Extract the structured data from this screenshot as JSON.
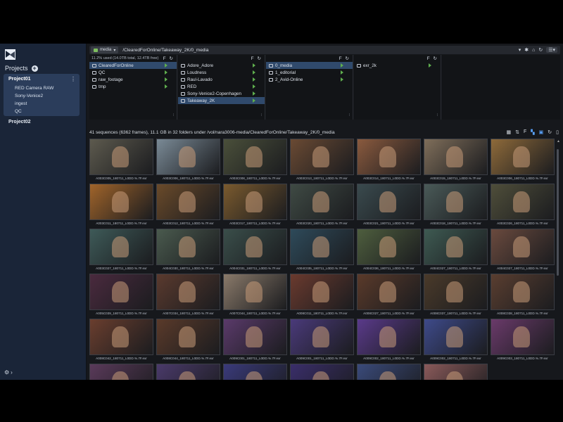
{
  "sidebar": {
    "projects_title": "Projects",
    "current_project": {
      "name": "Project01",
      "items": [
        "RED Camera RAW",
        "Sony-Venice2",
        "ingest",
        "QC"
      ]
    },
    "other_project": "Project02"
  },
  "pathbar": {
    "drive": "media",
    "path": "/ClearedForOnline/Takeaway_2K/0_media"
  },
  "browser": {
    "usage": "11.2% used (14.0TB total, 12.4TB free)",
    "columns": [
      {
        "items": [
          "ClearedForOnline",
          "QC",
          "raw_footage",
          "tmp"
        ],
        "selected": 0
      },
      {
        "items": [
          "Adore_Adore",
          "Loudness",
          "Raul-Lavado",
          "RED",
          "Sony-Venice2-Copenhagen",
          "Takeaway_2K"
        ],
        "selected": 5
      },
      {
        "items": [
          "0_media",
          "1_editorial",
          "2_Avid-Online"
        ],
        "selected": 0
      },
      {
        "items": [
          "exr_2k"
        ],
        "selected": -1
      },
      {
        "items": [],
        "selected": -1
      }
    ]
  },
  "info": {
    "text": "41 sequences (6362 frames), 11.1 GB in 32 folders under /vol/nara3006-media/ClearedForOnline/Takeaway_2K/0_media"
  },
  "tiles": [
    {
      "caption": "A003C005_180711_L0DD.%.7F.exr",
      "color": "#5d5a4e"
    },
    {
      "caption": "A003C006_180711_L0DD.%.7F.exr",
      "color": "#7a8a96"
    },
    {
      "caption": "A003C008_180711_L0DD.%.7F.exr",
      "color": "#4a4f3a"
    },
    {
      "caption": "A003C013_180711_L0DD.%.7F.exr",
      "color": "#6a4a33"
    },
    {
      "caption": "A003C014_180711_L0DD.%.7F.exr",
      "color": "#8a5a3e"
    },
    {
      "caption": "A003C015_180711_L0DD.%.7F.exr",
      "color": "#7f6e5a"
    },
    {
      "caption": "A003C006_180711_L0DD.%.7F.exr",
      "color": "#8e6a3a"
    },
    {
      "caption": "A003C011_180711_L0DD.%.7F.exr",
      "color": "#a0642a"
    },
    {
      "caption": "A003C012_180711_L0DD.%.7F.exr",
      "color": "#6a4a2a"
    },
    {
      "caption": "A003C017_180711_L0DD.%.7F.exr",
      "color": "#7a5a2e"
    },
    {
      "caption": "A003C020_180711_L0DD.%.7F.exr",
      "color": "#3f4a44"
    },
    {
      "caption": "A003C021_180711_L0DD.%.7F.exr",
      "color": "#3a4a4e"
    },
    {
      "caption": "A003C018_180711_L0DD.%.7F.exr",
      "color": "#4a5a58"
    },
    {
      "caption": "A003C026_180711_L0DD.%.7F.exr",
      "color": "#4f4e3a"
    },
    {
      "caption": "A003C027_180711_L0DD.%.7F.exr",
      "color": "#3e5a58"
    },
    {
      "caption": "A004C030_180711_L0DD.%.7F.exr",
      "color": "#4a5a4e"
    },
    {
      "caption": "A004C031_180711_L0DD.%.7F.exr",
      "color": "#3a4e4a"
    },
    {
      "caption": "A004C035_180711_L0DD.%.7F.exr",
      "color": "#2e4a5a"
    },
    {
      "caption": "A004C036_180711_L0DD.%.7F.exr",
      "color": "#4e5e3e"
    },
    {
      "caption": "A004C027_180711_L0DD.%.7F.exr",
      "color": "#3e5a52"
    },
    {
      "caption": "A004C027_180711_L0DD.%.7F.exr",
      "color": "#6a4a3e"
    },
    {
      "caption": "A005C039_180711_L0DD.%.7F.exr",
      "color": "#4a2a3e"
    },
    {
      "caption": "A007C034_180711_L0DD.%.7F.exr",
      "color": "#5a3a2e"
    },
    {
      "caption": "A007C044_180711_L0DD.%.7F.exr",
      "color": "#8a7a6a"
    },
    {
      "caption": "A008C011_180711_L0DD.%.7F.exr",
      "color": "#6a3a2e"
    },
    {
      "caption": "A008C027_180711_L0DD.%.7F.exr",
      "color": "#5a3a2a"
    },
    {
      "caption": "A008C037_180711_L0DD.%.7F.exr",
      "color": "#4a3a2a"
    },
    {
      "caption": "A008C038_180711_L0DD.%.7F.exr",
      "color": "#5a3e30"
    },
    {
      "caption": "A008C042_180711_L0DD.%.7F.exr",
      "color": "#6a3e2e"
    },
    {
      "caption": "A008C044_180711_L0DD.%.7F.exr",
      "color": "#5a3a2a"
    },
    {
      "caption": "A009C001_180711_L0DD.%.7F.exr",
      "color": "#5a3a6a"
    },
    {
      "caption": "A009C001_180711_L0DD.%.7F.exr",
      "color": "#4a3a7a"
    },
    {
      "caption": "A009C002_180711_L0DD.%.7F.exr",
      "color": "#5a3a8a"
    },
    {
      "caption": "A009C002_180711_L0DD.%.7F.exr",
      "color": "#3e4a8a"
    },
    {
      "caption": "A009C003_180711_L0DD.%.7F.exr",
      "color": "#6a3a6a"
    },
    {
      "caption": "",
      "color": "#5a3a5a"
    },
    {
      "caption": "",
      "color": "#4a3a6a"
    },
    {
      "caption": "",
      "color": "#3a3a7a"
    },
    {
      "caption": "",
      "color": "#3a2e6a"
    },
    {
      "caption": "",
      "color": "#3a4a7a"
    },
    {
      "caption": "",
      "color": "#8a5a5a"
    }
  ],
  "colors": {
    "sidebar_bg": "#1a2538",
    "selected": "#304a6c",
    "accent": "#5aa3ff",
    "arrow": "#5fae4e"
  }
}
